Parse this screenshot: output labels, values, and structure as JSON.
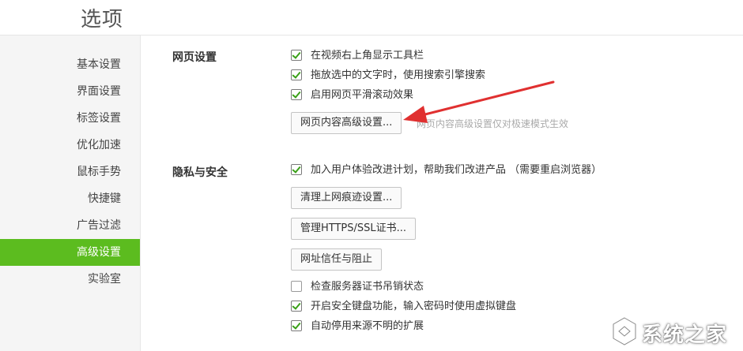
{
  "header": {
    "title": "选项"
  },
  "sidebar": {
    "items": [
      {
        "label": "基本设置",
        "active": false
      },
      {
        "label": "界面设置",
        "active": false
      },
      {
        "label": "标签设置",
        "active": false
      },
      {
        "label": "优化加速",
        "active": false
      },
      {
        "label": "鼠标手势",
        "active": false
      },
      {
        "label": "快捷键",
        "active": false
      },
      {
        "label": "广告过滤",
        "active": false
      },
      {
        "label": "高级设置",
        "active": true
      },
      {
        "label": "实验室",
        "active": false
      }
    ],
    "active_color": "#5cbc1f"
  },
  "web_settings": {
    "title": "网页设置",
    "options": [
      {
        "label": "在视频右上角显示工具栏",
        "checked": true
      },
      {
        "label": "拖放选中的文字时，使用搜索引擎搜索",
        "checked": true
      },
      {
        "label": "启用网页平滑滚动效果",
        "checked": true
      }
    ],
    "advanced_button": "网页内容高级设置...",
    "advanced_hint": "网页内容高级设置仅对极速模式生效"
  },
  "privacy": {
    "title": "隐私与安全",
    "ux_plan": {
      "label": "加入用户体验改进计划，帮助我们改进产品 （需要重启浏览器）",
      "checked": true
    },
    "clear_traces_button": "清理上网痕迹设置...",
    "https_button": "管理HTTPS/SSL证书...",
    "trust_button": "网址信任与阻止",
    "options": [
      {
        "label": "检查服务器证书吊销状态",
        "checked": false
      },
      {
        "label": "开启安全键盘功能，输入密码时使用虚拟键盘",
        "checked": true
      },
      {
        "label": "自动停用来源不明的扩展",
        "checked": true
      }
    ]
  },
  "annotation": {
    "color": "#e03030"
  },
  "watermark": {
    "text": "系统之家"
  }
}
